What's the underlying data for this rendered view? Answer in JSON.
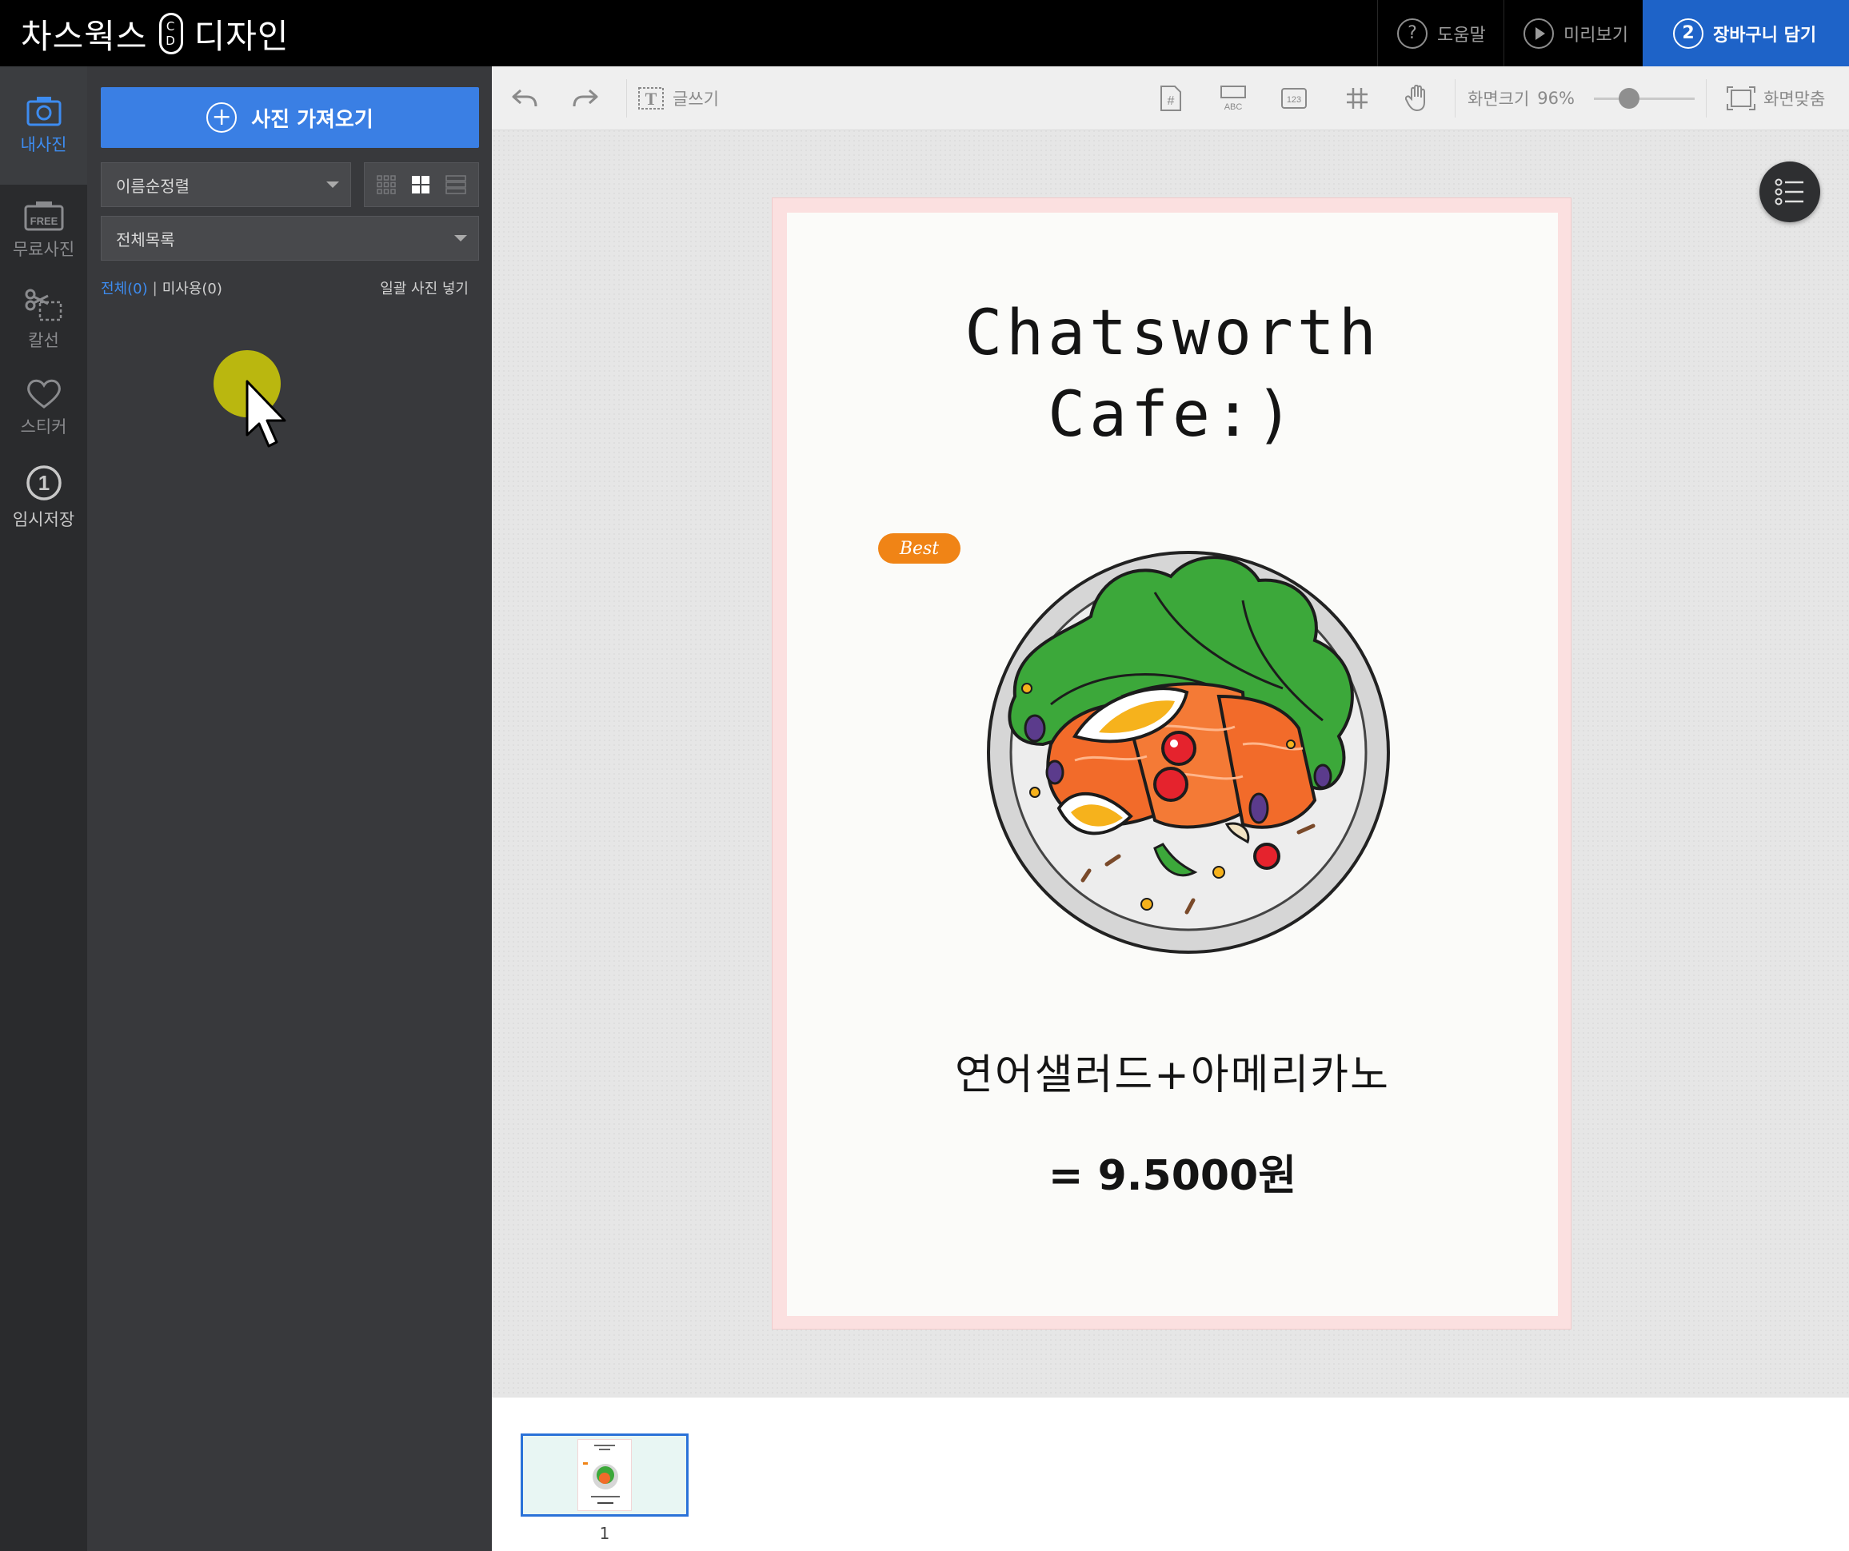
{
  "header": {
    "brand_left": "차스웍스",
    "brand_mark_top": "C",
    "brand_mark_bottom": "D",
    "brand_right": "디자인",
    "help_icon": "?",
    "help_label": "도움말",
    "preview_label": "미리보기",
    "cart_step": "2",
    "cart_label": "장바구니 담기"
  },
  "rail": {
    "items": [
      {
        "label": "내사진",
        "icon": "camera-icon",
        "active": true
      },
      {
        "label": "무료사진",
        "icon": "free-photo-icon",
        "badge": "FREE"
      },
      {
        "label": "칼선",
        "icon": "scissors-icon"
      },
      {
        "label": "스티커",
        "icon": "heart-icon"
      },
      {
        "label": "임시저장",
        "icon": "temp-save-icon",
        "badge": "1"
      }
    ]
  },
  "panel": {
    "import_label": "사진 가져오기",
    "sort_value": "이름순정렬",
    "list_value": "전체목록",
    "filter_all": "전체(0)",
    "filter_sep": "|",
    "filter_unused": "미사용(0)",
    "bulk_insert": "일괄 사진 넣기"
  },
  "toolbar": {
    "text_tool_label": "글쓰기",
    "text_tool_glyph": "T",
    "page_num_glyph": "#",
    "abc_glyph": "ABC",
    "num_glyph": "123",
    "zoom_label": "화면크기",
    "zoom_value": "96%",
    "zoom_fraction": 0.35,
    "fit_label": "화면맞춤"
  },
  "design": {
    "title_line1": "Chatsworth",
    "title_line2": "Cafe:)",
    "badge": "Best",
    "menu_item": "연어샐러드+아메리카노",
    "price": "= 9.5000원"
  },
  "pages": {
    "current": "1"
  },
  "colors": {
    "accent_blue": "#1e63c8",
    "import_blue": "#3a7fe4",
    "best_orange": "#f08416",
    "cursor_highlight": "#c6c20c"
  }
}
